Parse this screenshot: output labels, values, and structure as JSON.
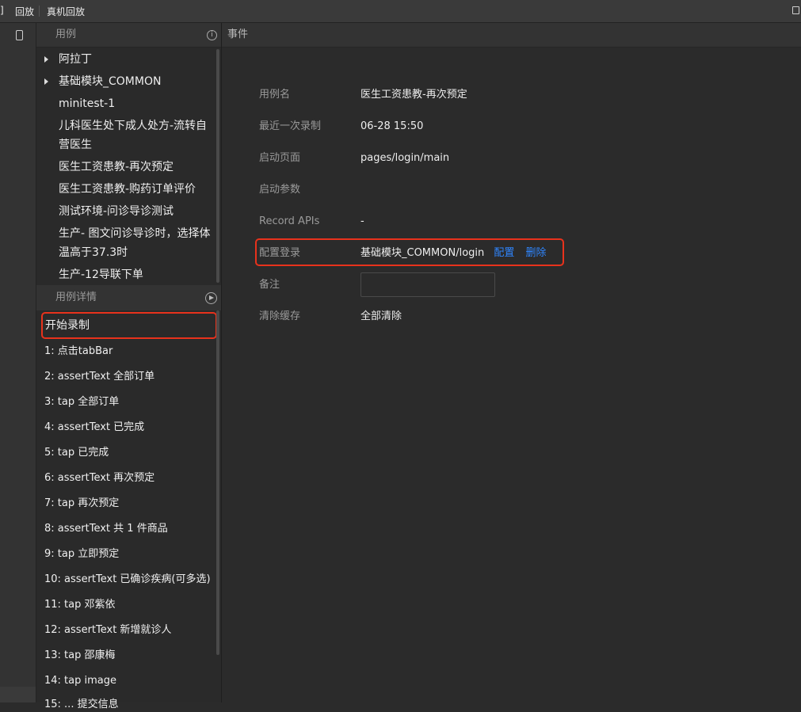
{
  "topbar": {
    "fragment": "]",
    "menu_playback": "回放",
    "menu_device_playback": "真机回放"
  },
  "cases_panel": {
    "header": "用例",
    "items": [
      {
        "label": "阿拉丁",
        "expandable": true
      },
      {
        "label": "基础模块_COMMON",
        "expandable": true
      },
      {
        "label": "minitest-1"
      },
      {
        "label": "儿科医生处下成人处方-流转自营医生"
      },
      {
        "label": "医生工资患教-再次预定"
      },
      {
        "label": "医生工资患教-购药订单评价"
      },
      {
        "label": "测试环境-问诊导诊测试"
      },
      {
        "label": "生产- 图文问诊导诊时，选择体温高于37.3时"
      },
      {
        "label": "生产-12导联下单"
      }
    ]
  },
  "detail_panel": {
    "header": "用例详情",
    "start_record": "开始录制",
    "steps": [
      "1: 点击tabBar",
      "2: assertText 全部订单",
      "3: tap 全部订单",
      "4: assertText 已完成",
      "5: tap 已完成",
      "6: assertText 再次预定",
      "7: tap 再次预定",
      "8: assertText 共 1 件商品",
      "9: tap 立即预定",
      "10: assertText 已确诊疾病(可多选)",
      "11: tap 邓紫依",
      "12: assertText 新增就诊人",
      "13: tap 邵康梅",
      "14: tap image",
      "15: ... 提交信息"
    ]
  },
  "events_panel": {
    "header": "事件",
    "case_name_label": "用例名",
    "case_name_value": "医生工资患教-再次预定",
    "last_recorded_label": "最近一次录制",
    "last_recorded_value": "06-28 15:50",
    "start_page_label": "启动页面",
    "start_page_value": "pages/login/main",
    "start_params_label": "启动参数",
    "start_params_value": "",
    "record_apis_label": "Record APIs",
    "record_apis_value": "-",
    "login_config_label": "配置登录",
    "login_config_value": "基础模块_COMMON/login",
    "configure_link": "配置",
    "delete_link": "删除",
    "note_label": "备注",
    "note_value": "",
    "clear_cache_label": "清除缓存",
    "clear_all_link": "全部清除"
  },
  "colors": {
    "accent_link": "#2f86ff",
    "highlight_border": "#e8321c"
  }
}
